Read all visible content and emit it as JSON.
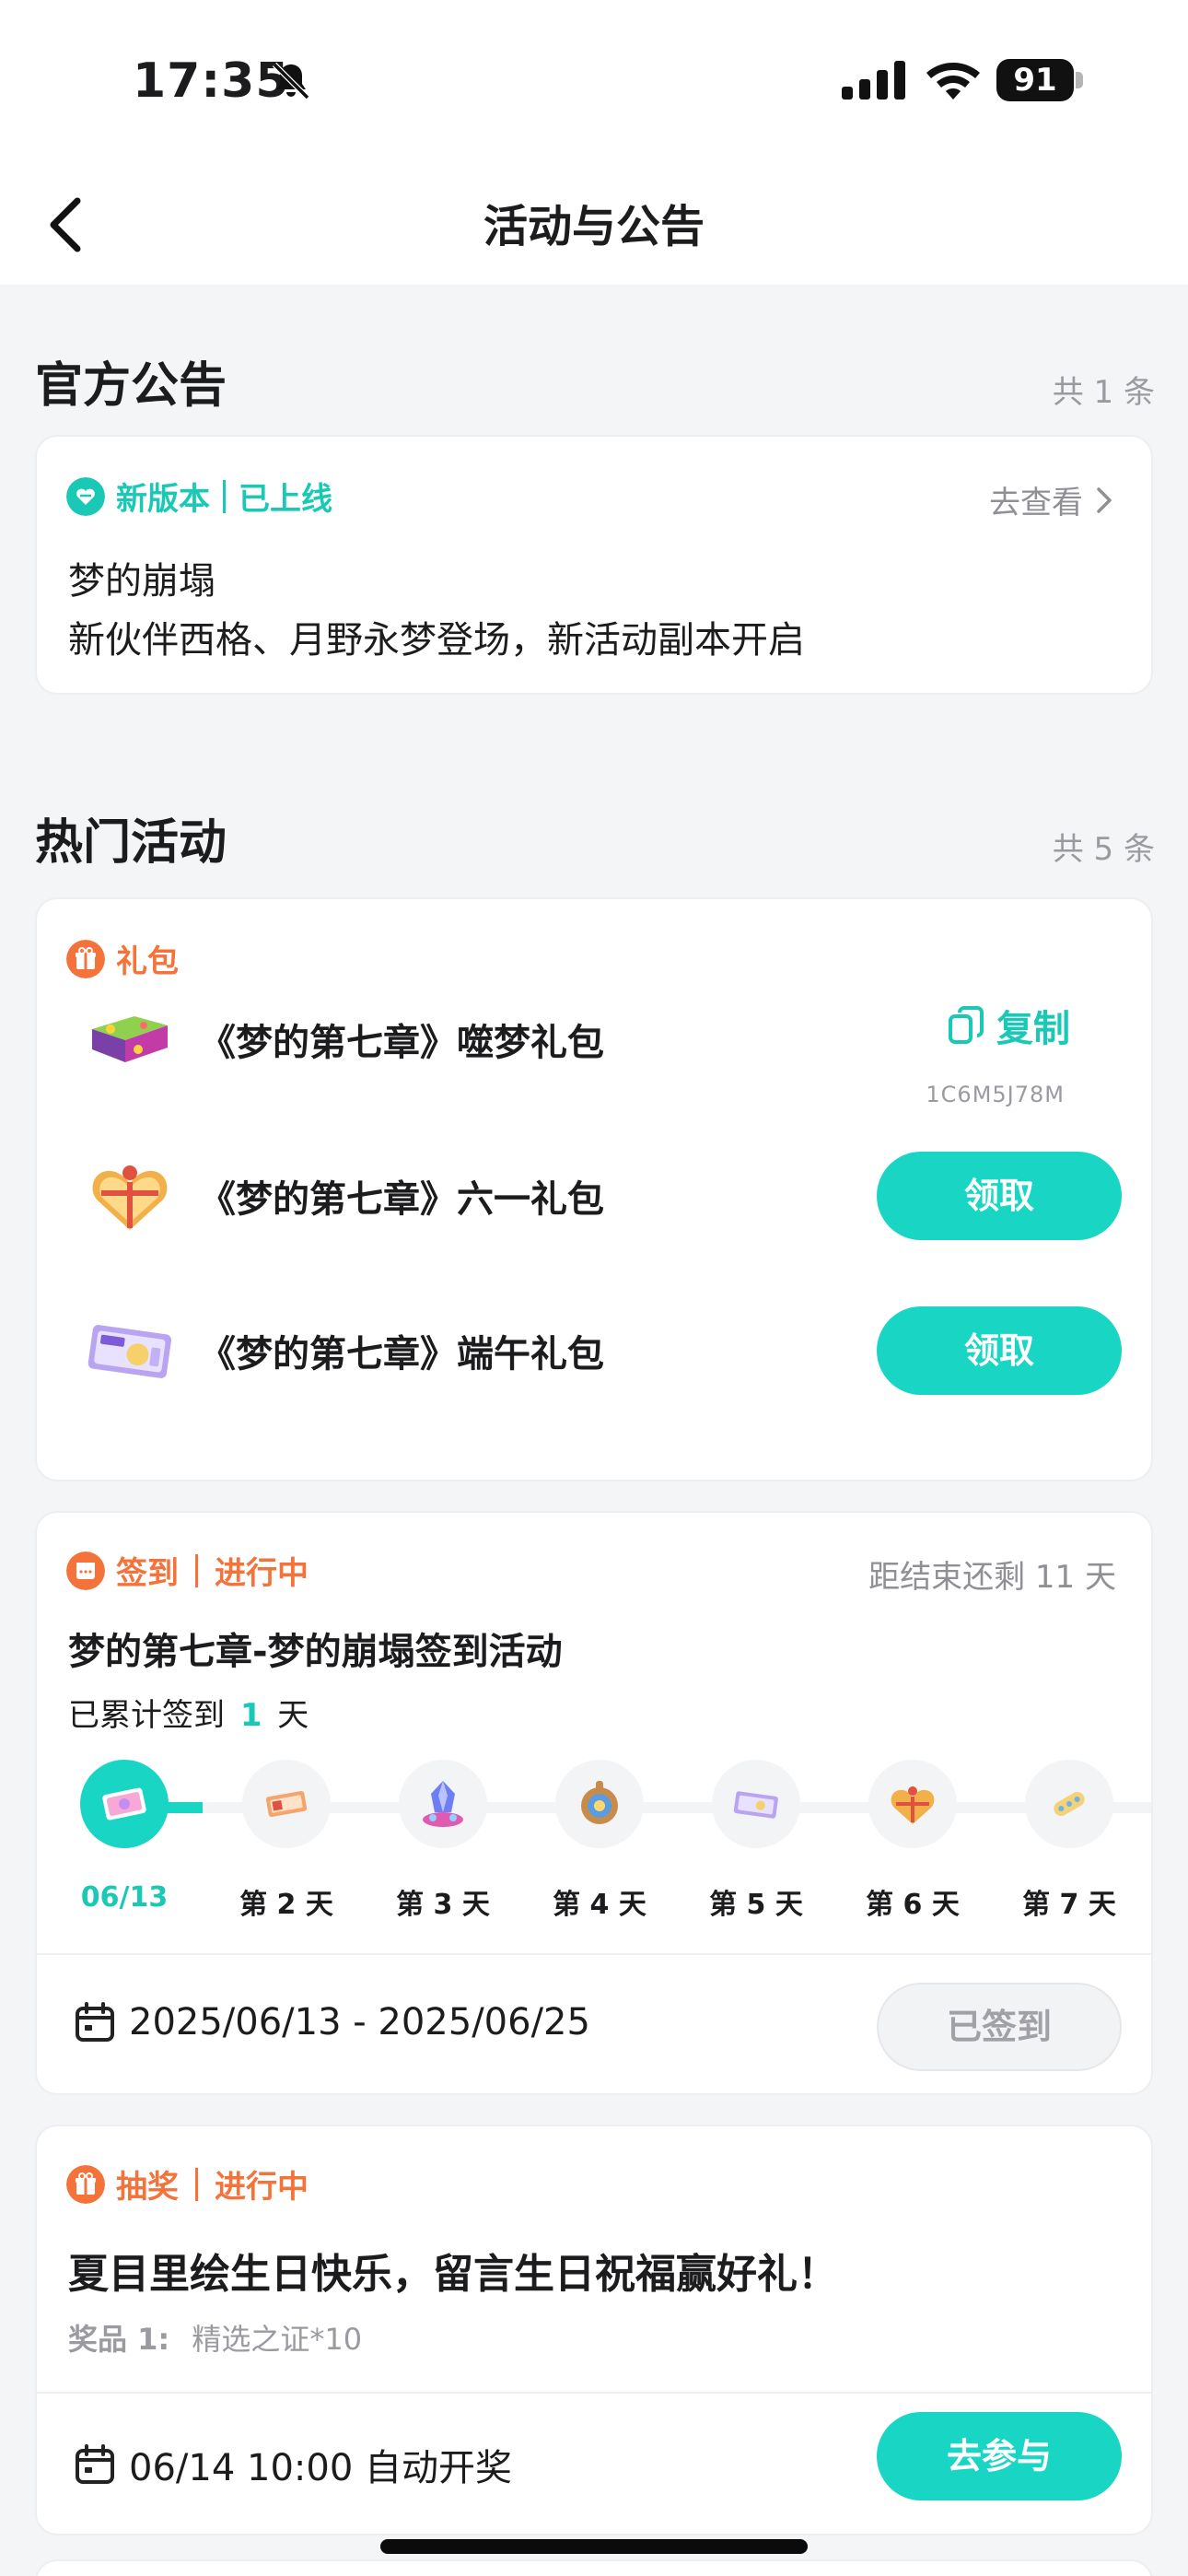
{
  "status_bar": {
    "time": "17:35",
    "battery": "91"
  },
  "nav": {
    "title": "活动与公告"
  },
  "official": {
    "title": "官方公告",
    "count": "共 1 条",
    "card": {
      "tag": "新版本",
      "status": "已上线",
      "link": "去查看",
      "headline": "梦的崩塌",
      "desc": "新伙伴西格、月野永梦登场，新活动副本开启"
    }
  },
  "hot": {
    "title": "热门活动",
    "count": "共 5 条",
    "gift_card": {
      "tag": "礼包",
      "items": [
        {
          "name": "《梦的第七章》噬梦礼包",
          "action": "复制",
          "code": "1C6M5J78M"
        },
        {
          "name": "《梦的第七章》六一礼包",
          "action": "领取"
        },
        {
          "name": "《梦的第七章》端午礼包",
          "action": "领取"
        }
      ]
    },
    "checkin_card": {
      "tag": "签到",
      "status": "进行中",
      "remaining": "距结束还剩 11 天",
      "title": "梦的第七章-梦的崩塌签到活动",
      "progress_prefix": "已累计签到",
      "progress_days": "1",
      "progress_suffix": "天",
      "days": [
        "06/13",
        "第 2 天",
        "第 3 天",
        "第 4 天",
        "第 5 天",
        "第 6 天",
        "第 7 天"
      ],
      "date_range": "2025/06/13 - 2025/06/25",
      "button": "已签到"
    },
    "lottery_card": {
      "tag": "抽奖",
      "status": "进行中",
      "title": "夏目里绘生日快乐，留言生日祝福赢好礼！",
      "prize_label": "奖品 1:",
      "prize_value": "精选之证*10",
      "draw_time": "06/14 10:00 自动开奖",
      "button": "去参与"
    }
  },
  "colors": {
    "accent": "#18d6c3",
    "orange": "#f4733a",
    "background": "#f4f5f7"
  }
}
